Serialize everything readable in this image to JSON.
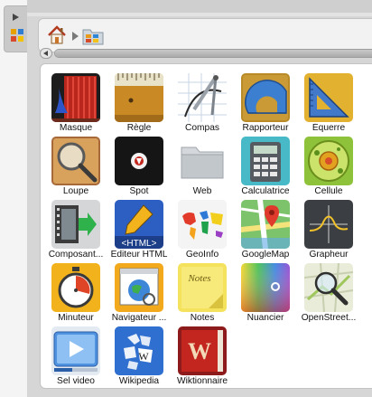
{
  "breadcrumb": {
    "home_icon": "home-icon",
    "folder_icon": "apps-folder-icon"
  },
  "tools": [
    {
      "label": "Masque",
      "icon": "mask-icon"
    },
    {
      "label": "Règle",
      "icon": "ruler-icon"
    },
    {
      "label": "Compas",
      "icon": "compass-icon"
    },
    {
      "label": "Rapporteur",
      "icon": "protractor-icon"
    },
    {
      "label": "Équerre",
      "icon": "set-square-icon"
    },
    {
      "label": "Loupe",
      "icon": "magnifier-icon"
    },
    {
      "label": "Spot",
      "icon": "spotlight-icon"
    },
    {
      "label": "Web",
      "icon": "folder-icon"
    },
    {
      "label": "Calculatrice",
      "icon": "calculator-icon"
    },
    {
      "label": "Cellule",
      "icon": "cell-icon"
    },
    {
      "label": "Composant...",
      "icon": "component-icon"
    },
    {
      "label": "Editeur HTML",
      "icon": "html-editor-icon"
    },
    {
      "label": "GeoInfo",
      "icon": "world-map-icon"
    },
    {
      "label": "GoogleMap",
      "icon": "map-pin-icon"
    },
    {
      "label": "Grapheur",
      "icon": "graph-icon"
    },
    {
      "label": "Minuteur",
      "icon": "timer-icon"
    },
    {
      "label": "Navigateur ...",
      "icon": "browser-icon"
    },
    {
      "label": "Notes",
      "icon": "notes-icon"
    },
    {
      "label": "Nuancier",
      "icon": "color-picker-icon"
    },
    {
      "label": "OpenStreet...",
      "icon": "street-map-icon"
    },
    {
      "label": "Sel video",
      "icon": "video-icon"
    },
    {
      "label": "Wikipedia",
      "icon": "wikipedia-icon"
    },
    {
      "label": "Wiktionnaire",
      "icon": "wiktionary-icon"
    }
  ],
  "icon_texts": {
    "html": "<HTML>",
    "notes": "Notes",
    "wiki_w": "W"
  }
}
